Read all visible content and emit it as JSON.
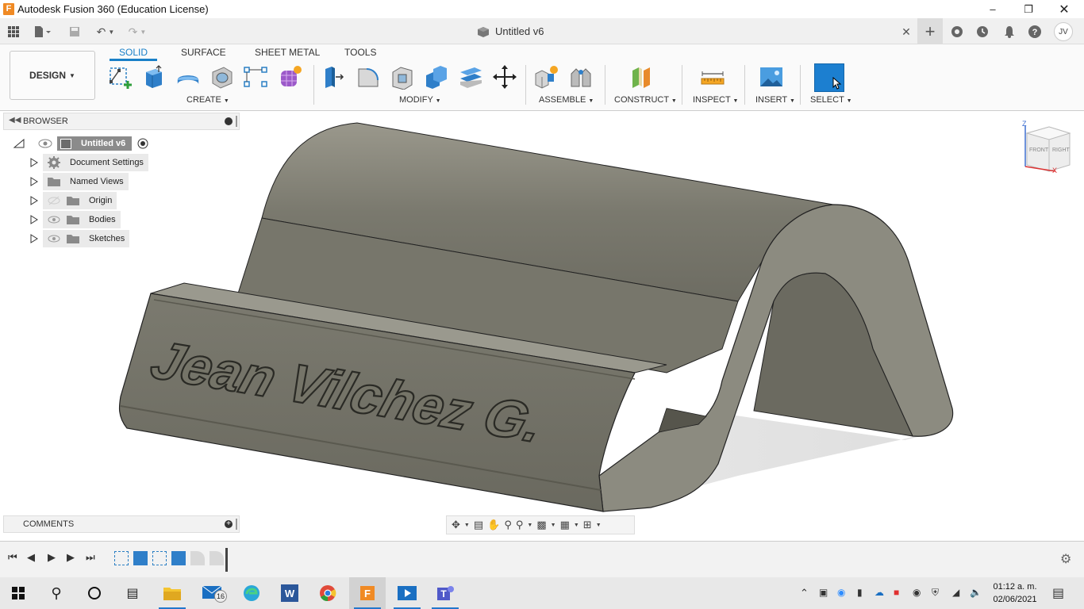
{
  "window": {
    "title": "Autodesk Fusion 360 (Education License)",
    "app_icon_letter": "F"
  },
  "quick_access": {
    "doc_tab_title": "Untitled v6",
    "user_initials": "JV"
  },
  "ribbon": {
    "workspace": "DESIGN",
    "tabs": [
      {
        "label": "SOLID",
        "active": true
      },
      {
        "label": "SURFACE",
        "active": false
      },
      {
        "label": "SHEET METAL",
        "active": false
      },
      {
        "label": "TOOLS",
        "active": false
      }
    ],
    "groups": {
      "create": "CREATE",
      "modify": "MODIFY",
      "assemble": "ASSEMBLE",
      "construct": "CONSTRUCT",
      "inspect": "INSPECT",
      "insert": "INSERT",
      "select": "SELECT"
    }
  },
  "browser": {
    "header": "BROWSER",
    "root": "Untitled v6",
    "items": [
      {
        "label": "Document Settings",
        "icon": "gear-icon"
      },
      {
        "label": "Named Views",
        "icon": "folder-icon"
      },
      {
        "label": "Origin",
        "icon": "folder-icon"
      },
      {
        "label": "Bodies",
        "icon": "folder-icon"
      },
      {
        "label": "Sketches",
        "icon": "folder-icon"
      }
    ]
  },
  "model": {
    "engraved_text": "Jean Vilchez G."
  },
  "viewcube": {
    "front": "FRONT",
    "right": "RIGHT",
    "z_axis": "Z",
    "x_axis": "X"
  },
  "comments": {
    "header": "COMMENTS"
  },
  "taskbar": {
    "mail_badge": "16",
    "time": "01:12 a. m.",
    "date": "02/06/2021"
  },
  "colors": {
    "accent": "#1a80c8",
    "model_body": "#7e7d72",
    "select_tile": "#1c7fd0",
    "fusion_orange": "#f08a24"
  }
}
